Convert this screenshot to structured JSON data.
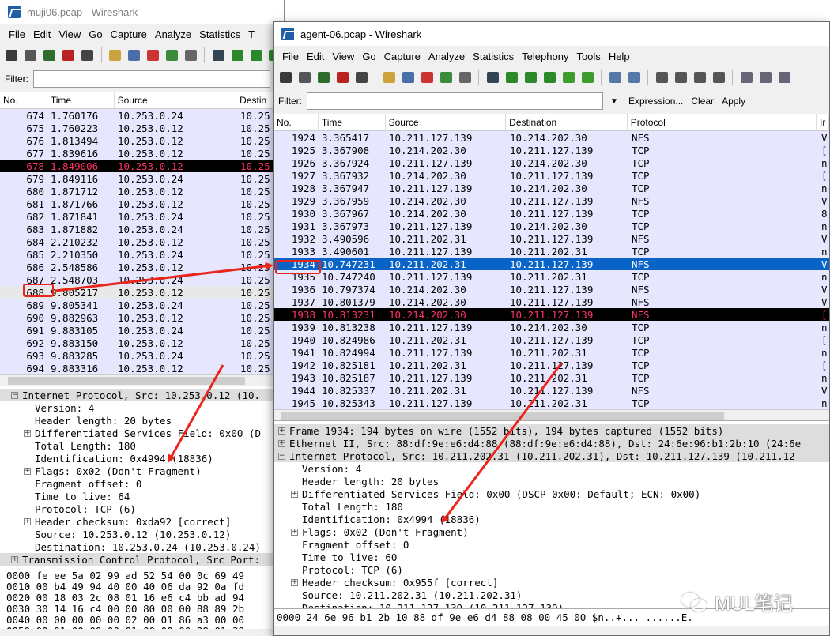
{
  "w1": {
    "title": "muji06.pcap - Wireshark",
    "menu": [
      "File",
      "Edit",
      "View",
      "Go",
      "Capture",
      "Analyze",
      "Statistics",
      "T"
    ],
    "filter_label": "Filter:",
    "columns": [
      "No.",
      "Time",
      "Source",
      "Destin"
    ],
    "rows": [
      {
        "no": "674",
        "time": "1.760176",
        "src": "10.253.0.24",
        "dst": "10.25",
        "kind": "tcp"
      },
      {
        "no": "675",
        "time": "1.760223",
        "src": "10.253.0.12",
        "dst": "10.25",
        "kind": "tcp"
      },
      {
        "no": "676",
        "time": "1.813494",
        "src": "10.253.0.12",
        "dst": "10.25",
        "kind": "tcp"
      },
      {
        "no": "677",
        "time": "1.839616",
        "src": "10.253.0.12",
        "dst": "10.25",
        "kind": "tcp"
      },
      {
        "no": "678",
        "time": "1.849006",
        "src": "10.253.0.12",
        "dst": "10.25",
        "kind": "err"
      },
      {
        "no": "679",
        "time": "1.849116",
        "src": "10.253.0.24",
        "dst": "10.25",
        "kind": "tcp"
      },
      {
        "no": "680",
        "time": "1.871712",
        "src": "10.253.0.12",
        "dst": "10.25",
        "kind": "tcp"
      },
      {
        "no": "681",
        "time": "1.871766",
        "src": "10.253.0.12",
        "dst": "10.25",
        "kind": "tcp"
      },
      {
        "no": "682",
        "time": "1.871841",
        "src": "10.253.0.24",
        "dst": "10.25",
        "kind": "tcp"
      },
      {
        "no": "683",
        "time": "1.871882",
        "src": "10.253.0.24",
        "dst": "10.25",
        "kind": "tcp"
      },
      {
        "no": "684",
        "time": "2.210232",
        "src": "10.253.0.12",
        "dst": "10.25",
        "kind": "tcp"
      },
      {
        "no": "685",
        "time": "2.210350",
        "src": "10.253.0.24",
        "dst": "10.25",
        "kind": "tcp"
      },
      {
        "no": "686",
        "time": "2.548586",
        "src": "10.253.0.12",
        "dst": "10.25",
        "kind": "tcp"
      },
      {
        "no": "687",
        "time": "2.548703",
        "src": "10.253.0.24",
        "dst": "10.25",
        "kind": "tcp"
      },
      {
        "no": "688",
        "time": "9.805217",
        "src": "10.253.0.12",
        "dst": "10.25",
        "kind": "gray"
      },
      {
        "no": "689",
        "time": "9.805341",
        "src": "10.253.0.24",
        "dst": "10.25",
        "kind": "tcp"
      },
      {
        "no": "690",
        "time": "9.882963",
        "src": "10.253.0.12",
        "dst": "10.25",
        "kind": "tcp"
      },
      {
        "no": "691",
        "time": "9.883105",
        "src": "10.253.0.24",
        "dst": "10.25",
        "kind": "tcp"
      },
      {
        "no": "692",
        "time": "9.883150",
        "src": "10.253.0.12",
        "dst": "10.25",
        "kind": "tcp"
      },
      {
        "no": "693",
        "time": "9.883285",
        "src": "10.253.0.24",
        "dst": "10.25",
        "kind": "tcp"
      },
      {
        "no": "694",
        "time": "9.883316",
        "src": "10.253.0.12",
        "dst": "10.25",
        "kind": "tcp"
      }
    ],
    "detail": [
      {
        "t": "Internet Protocol, Src: 10.253.0.12 (10.",
        "lvl": 0,
        "exp": "−",
        "hl": true
      },
      {
        "t": "Version: 4",
        "lvl": 1
      },
      {
        "t": "Header length: 20 bytes",
        "lvl": 1
      },
      {
        "t": "Differentiated Services Field: 0x00 (D",
        "lvl": 1,
        "exp": "+"
      },
      {
        "t": "Total Length: 180",
        "lvl": 1
      },
      {
        "t": "Identification: 0x4994 (18836)",
        "lvl": 1
      },
      {
        "t": "Flags: 0x02 (Don't Fragment)",
        "lvl": 1,
        "exp": "+"
      },
      {
        "t": "Fragment offset: 0",
        "lvl": 1
      },
      {
        "t": "Time to live: 64",
        "lvl": 1
      },
      {
        "t": "Protocol: TCP (6)",
        "lvl": 1
      },
      {
        "t": "Header checksum: 0xda92 [correct]",
        "lvl": 1,
        "exp": "+"
      },
      {
        "t": "Source: 10.253.0.12 (10.253.0.12)",
        "lvl": 1
      },
      {
        "t": "Destination: 10.253.0.24 (10.253.0.24)",
        "lvl": 1
      },
      {
        "t": "Transmission Control Protocol, Src Port:",
        "lvl": 0,
        "exp": "+",
        "hl": true
      }
    ],
    "hex": [
      "0000  fe ee 5a 02 99 ad 52 54  00 0c 69 49",
      "0010  00 b4 49 94 40 00 40 06  da 92 0a fd",
      "0020  00 18 03 2c 08 01 16 e6  c4 bb ad 94",
      "0030  30 14 16 c4 00 00 80 00  00 88 89 2b",
      "0040  00 00 00 00 00 02 00 01  86 a3 00 00",
      "0050  00 01 00 00 00 01 00 00  00 28 01 39"
    ]
  },
  "w2": {
    "title": "agent-06.pcap - Wireshark",
    "menu": [
      "File",
      "Edit",
      "View",
      "Go",
      "Capture",
      "Analyze",
      "Statistics",
      "Telephony",
      "Tools",
      "Help"
    ],
    "filter_label": "Filter:",
    "expression": "Expression...",
    "clear": "Clear",
    "apply": "Apply",
    "columns": [
      "No.",
      "Time",
      "Source",
      "Destination",
      "Protocol",
      "Ir"
    ],
    "rows": [
      {
        "no": "1924",
        "time": "3.365417",
        "src": "10.211.127.139",
        "dst": "10.214.202.30",
        "proto": "NFS",
        "info": "V",
        "kind": "nfs"
      },
      {
        "no": "1925",
        "time": "3.367908",
        "src": "10.214.202.30",
        "dst": "10.211.127.139",
        "proto": "TCP",
        "info": "[",
        "kind": "tcp"
      },
      {
        "no": "1926",
        "time": "3.367924",
        "src": "10.211.127.139",
        "dst": "10.214.202.30",
        "proto": "TCP",
        "info": "n",
        "kind": "tcp"
      },
      {
        "no": "1927",
        "time": "3.367932",
        "src": "10.214.202.30",
        "dst": "10.211.127.139",
        "proto": "TCP",
        "info": "[",
        "kind": "tcp"
      },
      {
        "no": "1928",
        "time": "3.367947",
        "src": "10.211.127.139",
        "dst": "10.214.202.30",
        "proto": "TCP",
        "info": "n",
        "kind": "tcp"
      },
      {
        "no": "1929",
        "time": "3.367959",
        "src": "10.214.202.30",
        "dst": "10.211.127.139",
        "proto": "NFS",
        "info": "V",
        "kind": "nfs"
      },
      {
        "no": "1930",
        "time": "3.367967",
        "src": "10.214.202.30",
        "dst": "10.211.127.139",
        "proto": "TCP",
        "info": "8",
        "kind": "tcp"
      },
      {
        "no": "1931",
        "time": "3.367973",
        "src": "10.211.127.139",
        "dst": "10.214.202.30",
        "proto": "TCP",
        "info": "n",
        "kind": "tcp"
      },
      {
        "no": "1932",
        "time": "3.490596",
        "src": "10.211.202.31",
        "dst": "10.211.127.139",
        "proto": "NFS",
        "info": "V",
        "kind": "nfs"
      },
      {
        "no": "1933",
        "time": "3.490601",
        "src": "10.211.127.139",
        "dst": "10.211.202.31",
        "proto": "TCP",
        "info": "n",
        "kind": "tcp"
      },
      {
        "no": "1934",
        "time": "10.747231",
        "src": "10.211.202.31",
        "dst": "10.211.127.139",
        "proto": "NFS",
        "info": "V",
        "kind": "sel"
      },
      {
        "no": "1935",
        "time": "10.747240",
        "src": "10.211.127.139",
        "dst": "10.211.202.31",
        "proto": "TCP",
        "info": "n",
        "kind": "tcp"
      },
      {
        "no": "1936",
        "time": "10.797374",
        "src": "10.214.202.30",
        "dst": "10.211.127.139",
        "proto": "NFS",
        "info": "V",
        "kind": "nfs"
      },
      {
        "no": "1937",
        "time": "10.801379",
        "src": "10.214.202.30",
        "dst": "10.211.127.139",
        "proto": "NFS",
        "info": "V",
        "kind": "nfs"
      },
      {
        "no": "1938",
        "time": "10.813231",
        "src": "10.214.202.30",
        "dst": "10.211.127.139",
        "proto": "NFS",
        "info": "[",
        "kind": "err"
      },
      {
        "no": "1939",
        "time": "10.813238",
        "src": "10.211.127.139",
        "dst": "10.214.202.30",
        "proto": "TCP",
        "info": "n",
        "kind": "tcp"
      },
      {
        "no": "1940",
        "time": "10.824986",
        "src": "10.211.202.31",
        "dst": "10.211.127.139",
        "proto": "TCP",
        "info": "[",
        "kind": "tcp"
      },
      {
        "no": "1941",
        "time": "10.824994",
        "src": "10.211.127.139",
        "dst": "10.211.202.31",
        "proto": "TCP",
        "info": "n",
        "kind": "tcp"
      },
      {
        "no": "1942",
        "time": "10.825181",
        "src": "10.211.202.31",
        "dst": "10.211.127.139",
        "proto": "TCP",
        "info": "[",
        "kind": "tcp"
      },
      {
        "no": "1943",
        "time": "10.825187",
        "src": "10.211.127.139",
        "dst": "10.211.202.31",
        "proto": "TCP",
        "info": "n",
        "kind": "tcp"
      },
      {
        "no": "1944",
        "time": "10.825337",
        "src": "10.211.202.31",
        "dst": "10.211.127.139",
        "proto": "NFS",
        "info": "V",
        "kind": "nfs"
      },
      {
        "no": "1945",
        "time": "10.825343",
        "src": "10.211.127.139",
        "dst": "10.211.202.31",
        "proto": "TCP",
        "info": "n",
        "kind": "tcp"
      }
    ],
    "detail": [
      {
        "t": "Frame 1934: 194 bytes on wire (1552 bits), 194 bytes captured (1552 bits)",
        "lvl": 0,
        "exp": "+",
        "hl": true
      },
      {
        "t": "Ethernet II, Src: 88:df:9e:e6:d4:88 (88:df:9e:e6:d4:88), Dst: 24:6e:96:b1:2b:10 (24:6e",
        "lvl": 0,
        "exp": "+",
        "hl": true
      },
      {
        "t": "Internet Protocol, Src: 10.211.202.31 (10.211.202.31), Dst: 10.211.127.139 (10.211.12",
        "lvl": 0,
        "exp": "−",
        "hl": true
      },
      {
        "t": "Version: 4",
        "lvl": 1
      },
      {
        "t": "Header length: 20 bytes",
        "lvl": 1
      },
      {
        "t": "Differentiated Services Field: 0x00 (DSCP 0x00: Default; ECN: 0x00)",
        "lvl": 1,
        "exp": "+"
      },
      {
        "t": "Total Length: 180",
        "lvl": 1
      },
      {
        "t": "Identification: 0x4994 (18836)",
        "lvl": 1
      },
      {
        "t": "Flags: 0x02 (Don't Fragment)",
        "lvl": 1,
        "exp": "+"
      },
      {
        "t": "Fragment offset: 0",
        "lvl": 1
      },
      {
        "t": "Time to live: 60",
        "lvl": 1
      },
      {
        "t": "Protocol: TCP (6)",
        "lvl": 1
      },
      {
        "t": "Header checksum: 0x955f [correct]",
        "lvl": 1,
        "exp": "+"
      },
      {
        "t": "Source: 10.211.202.31 (10.211.202.31)",
        "lvl": 1
      },
      {
        "t": "Destination: 10.211.127.139 (10.211.127.139)",
        "lvl": 1
      }
    ],
    "hex": "0000  24 6e 96 b1 2b 10 88 df  9e e6 d4 88 08 00 45 00   $n..+... ......E."
  },
  "watermark": "MUL笔记",
  "colors": {
    "selected": "#0a64c8",
    "error_bg": "#000000",
    "error_fg": "#ff3366",
    "row_bg": "#e7e6ff",
    "annotation": "#e8261c"
  },
  "icons": [
    "interfaces-icon",
    "options-icon",
    "start-icon",
    "stop-icon",
    "restart-icon",
    "open-icon",
    "save-icon",
    "close-icon",
    "reload-icon",
    "print-icon",
    "find-icon",
    "back-icon",
    "forward-icon",
    "goto-icon",
    "first-icon",
    "last-icon",
    "colorize-icon",
    "autoscroll-icon",
    "zoom-in-icon",
    "zoom-out-icon",
    "normal-size-icon",
    "resize-columns-icon",
    "capture-filters-icon",
    "display-filters-icon",
    "coloring-rules-icon"
  ]
}
